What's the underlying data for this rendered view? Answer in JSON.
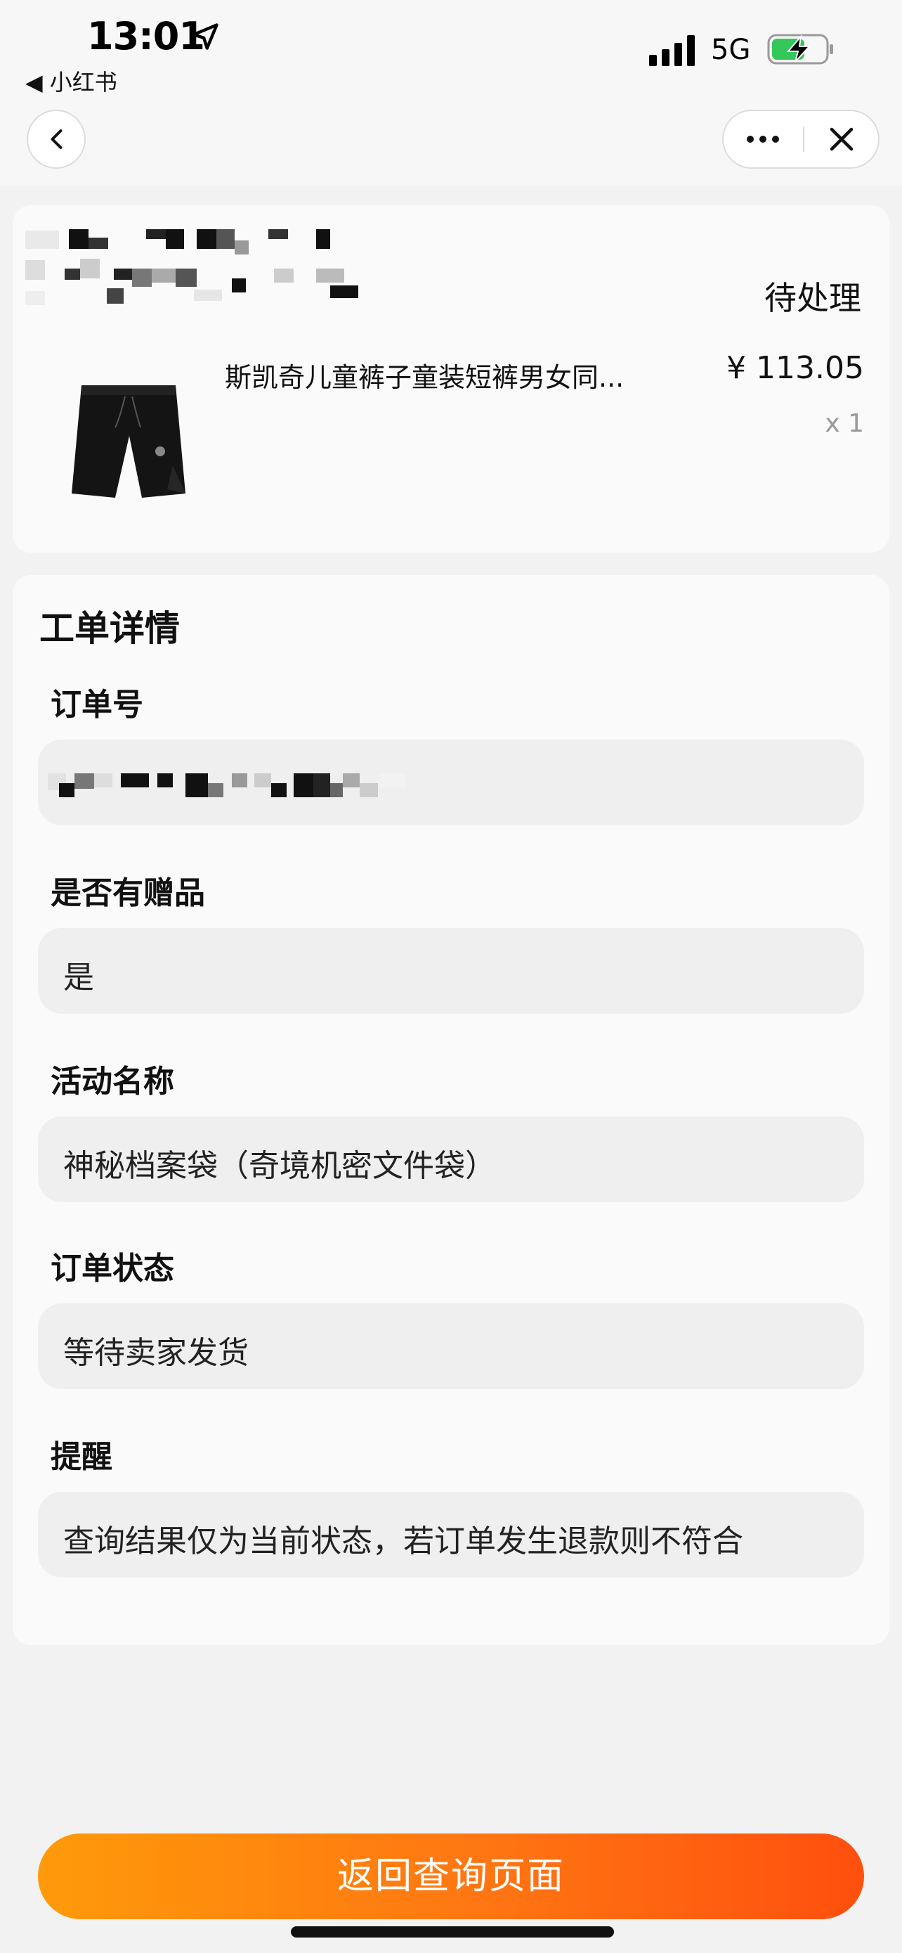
{
  "status_bar": {
    "time": "13:01",
    "back_app": "◀ 小红书",
    "network": "5G",
    "battery_color": "#34c759"
  },
  "nav": {
    "back_icon": "chevron-left-icon",
    "more_icon": "more-dots-icon",
    "close_icon": "close-icon"
  },
  "order": {
    "status": "待处理",
    "product_title": "斯凯奇儿童裤子童装短裤男女同...",
    "price": "¥ 113.05",
    "quantity": "x 1"
  },
  "details": {
    "title": "工单详情",
    "fields": [
      {
        "label": "订单号",
        "value": ""
      },
      {
        "label": "是否有赠品",
        "value": "是"
      },
      {
        "label": "活动名称",
        "value": "神秘档案袋（奇境机密文件袋）"
      },
      {
        "label": "订单状态",
        "value": "等待卖家发货"
      },
      {
        "label": "提醒",
        "value": "查询结果仅为当前状态，若订单发生退款则不符合"
      }
    ]
  },
  "actions": {
    "return_label": "返回查询页面"
  },
  "colors": {
    "accent_start": "#ff9a0a",
    "accent_end": "#ff4f0e"
  }
}
